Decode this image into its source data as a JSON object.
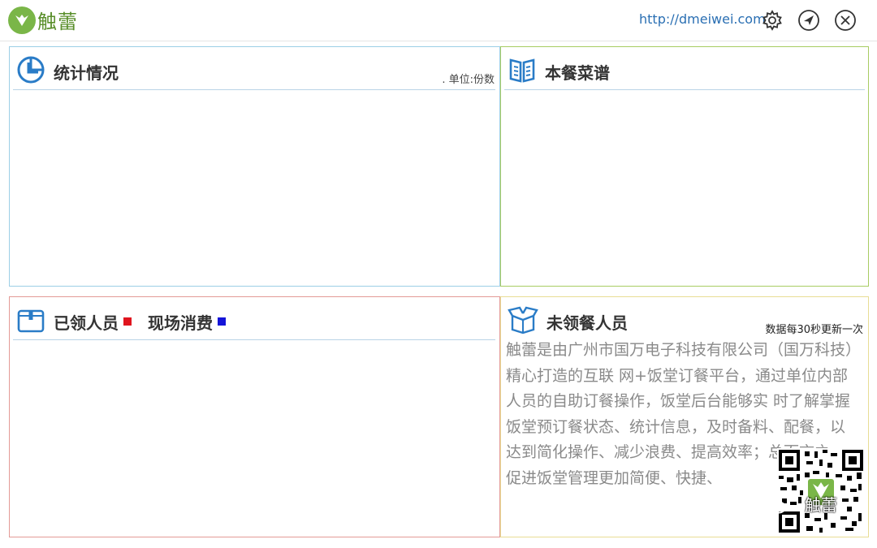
{
  "header": {
    "brand": "触蕾",
    "site_url": "http://dmeiwei.com",
    "icons": [
      "gear-icon",
      "navigate-icon",
      "close-icon"
    ]
  },
  "panels": {
    "stats": {
      "title": "统计情况",
      "unit": ". 单位:份数",
      "icon": "pie-chart-icon"
    },
    "menu": {
      "title": "本餐菜谱",
      "icon": "book-icon"
    },
    "received": {
      "title": "已领人员",
      "legend": [
        {
          "label": "已领人员",
          "color": "#e0141e"
        },
        {
          "label": "现场消费",
          "color": "#1414d8"
        }
      ],
      "icon": "box-icon"
    },
    "not_received": {
      "title": "未领餐人员",
      "refresh_note": "数据每30秒更新一次",
      "icon": "open-box-icon",
      "description": "触蕾是由广州市国万电子科技有限公司（国万科技）精心打造的互联 网+饭堂订餐平台，通过单位内部人员的自助订餐操作，饭堂后台能够实 时了解掌握饭堂预订餐状态、统计信息，及时备料、配餐，以达到简化操作、减少浪费、提高效率；总而言之，促进饭堂管理更加简便、快捷、",
      "qr_label": "触蕾"
    }
  },
  "colors": {
    "stats_border": "#9ccfe6",
    "menu_border": "#a8cc63",
    "received_border": "#e39a96",
    "not_received_border": "#e8dd95",
    "brand_green": "#7ab648",
    "icon_blue": "#2a7cc7"
  }
}
